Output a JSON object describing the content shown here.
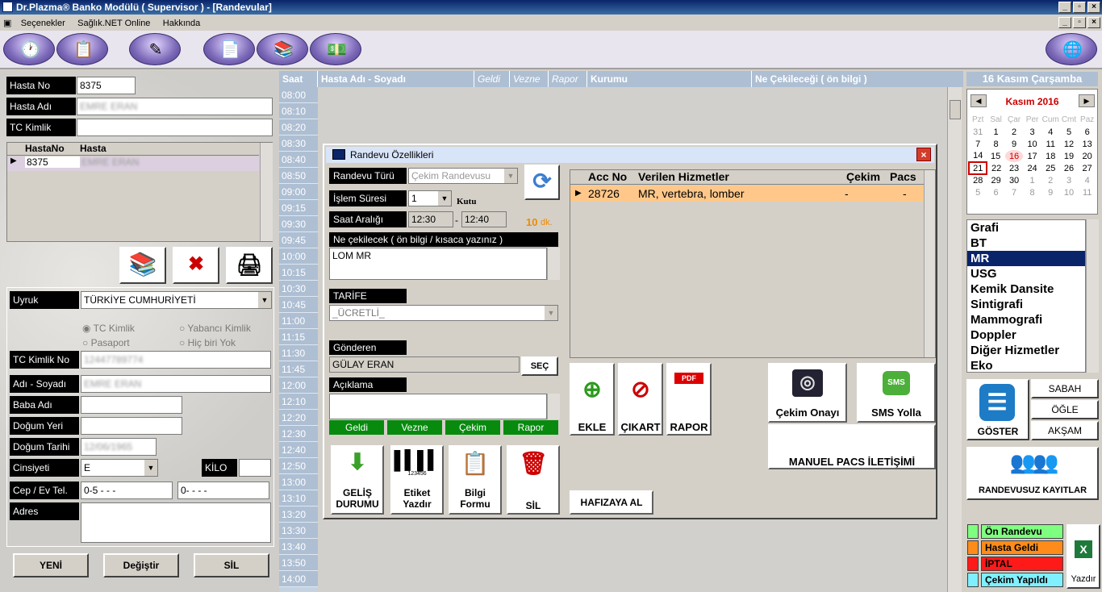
{
  "window": {
    "title": "Dr.Plazma® Banko Modülü ( Supervisor ) - [Randevular]"
  },
  "menu": [
    "Seçenekler",
    "Sağlık.NET Online",
    "Hakkında"
  ],
  "patient": {
    "hasta_no_label": "Hasta No",
    "hasta_no": "8375",
    "hasta_adi_label": "Hasta Adı",
    "hasta_adi": "EMRE ERAN",
    "tc_label": "TC Kimlik",
    "tc": "",
    "grid_headers": [
      "HastaNo",
      "Hasta"
    ],
    "grid_row": {
      "no": "8375",
      "name": "EMRE ERAN"
    }
  },
  "details": {
    "uyruk_label": "Uyruk",
    "uyruk": "TÜRKİYE CUMHURİYETİ",
    "radio_tc": "TC Kimlik",
    "radio_yabanci": "Yabancı Kimlik",
    "radio_pasaport": "Pasaport",
    "radio_hicbiri": "Hiç biri Yok",
    "tc_no_label": "TC Kimlik No",
    "tc_no": "12447789774",
    "ad_soyad_label": "Adı - Soyadı",
    "ad_soyad": "EMRE ERAN",
    "baba_label": "Baba Adı",
    "baba": "",
    "dogum_yeri_label": "Doğum Yeri",
    "dogum_yeri": "",
    "dogum_tarihi_label": "Doğum Tarihi",
    "dogum_tarihi": "12/06/1965",
    "cinsiyet_label": "Cinsiyeti",
    "cinsiyet": "E",
    "kilo_label": "KİLO",
    "kilo": "",
    "tel_label": "Cep / Ev Tel.",
    "cep": "0-5  -  -  -",
    "ev": "0-   -  -  -",
    "adres_label": "Adres",
    "adres": ""
  },
  "bottom_buttons": {
    "yeni": "YENİ",
    "degistir": "Değiştir",
    "sil": "SİL"
  },
  "schedule": {
    "headers": {
      "saat": "Saat",
      "hasta": "Hasta Adı - Soyadı",
      "geldi": "Geldi",
      "vezne": "Vezne",
      "rapor": "Rapor",
      "kurumu": "Kurumu",
      "ne": "Ne Çekileceği ( ön bilgi )"
    },
    "times": [
      "08:00",
      "08:10",
      "08:20",
      "08:30",
      "08:40",
      "08:50",
      "09:00",
      "09:15",
      "09:30",
      "09:45",
      "10:00",
      "10:15",
      "10:30",
      "10:45",
      "11:00",
      "11:15",
      "11:30",
      "11:45",
      "12:00",
      "12:10",
      "12:20",
      "12:30",
      "12:40",
      "12:50",
      "13:00",
      "13:10",
      "13:20",
      "13:30",
      "13:40",
      "13:50",
      "14:00"
    ]
  },
  "dialog": {
    "title": "Randevu Özellikleri",
    "randevu_turu_label": "Randevu Türü",
    "randevu_turu": "Çekim Randevusu",
    "islem_suresi_label": "İşlem Süresi",
    "islem_suresi": "1",
    "kutu": "Kutu",
    "saat_araligi_label": "Saat Aralığı",
    "saat_bas": "12:30",
    "saat_bit": "12:40",
    "dash": "-",
    "dk_value": "10",
    "dk_unit": "dk.",
    "ne_label": "Ne çekilecek ( ön bilgi / kısaca yazınız )",
    "ne": "LOM MR",
    "tarife_label": "TARİFE",
    "tarife": "_ÜCRETLİ_",
    "gonderen_label": "Gönderen",
    "gonderen": "GÜLAY ERAN",
    "sec": "SEÇ",
    "aciklama_label": "Açıklama",
    "aciklama": "",
    "status": [
      "Geldi",
      "Vezne",
      "Çekim",
      "Rapor"
    ],
    "services_headers": [
      "Acc No",
      "Verilen Hizmetler",
      "Çekim",
      "Pacs"
    ],
    "service_row": {
      "acc": "28726",
      "hizmet": "MR, vertebra, lomber",
      "cekim": "-",
      "pacs": "-"
    },
    "buttons": {
      "gelis": "GELİŞ DURUMU",
      "etiket": "Etiket Yazdır",
      "bilgi": "Bilgi Formu",
      "sil": "SİL",
      "hafiza": "HAFIZAYA AL",
      "ekle": "EKLE",
      "cikart": "ÇIKART",
      "rapor": "RAPOR",
      "cekim_onayi": "Çekim Onayı",
      "sms": "SMS Yolla",
      "manuel": "MANUEL PACS İLETİŞİMİ",
      "barcode": "123456",
      "pdf": "PDF",
      "sms_badge": "SMS"
    }
  },
  "right": {
    "date_header": "16 Kasım Çarşamba",
    "month": "Kasım 2016",
    "weekdays": [
      "Pzt",
      "Sal",
      "Çar",
      "Per",
      "Cum",
      "Cmt",
      "Paz"
    ],
    "weeks": [
      [
        "31",
        "1",
        "2",
        "3",
        "4",
        "5",
        "6"
      ],
      [
        "7",
        "8",
        "9",
        "10",
        "11",
        "12",
        "13"
      ],
      [
        "14",
        "15",
        "16",
        "17",
        "18",
        "19",
        "20"
      ],
      [
        "21",
        "22",
        "23",
        "24",
        "25",
        "26",
        "27"
      ],
      [
        "28",
        "29",
        "30",
        "1",
        "2",
        "3",
        "4"
      ],
      [
        "5",
        "6",
        "7",
        "8",
        "9",
        "10",
        "11"
      ]
    ],
    "modalities": [
      "Grafi",
      "BT",
      "MR",
      "USG",
      "Kemik Dansite",
      "Sintigrafi",
      "Mammografi",
      "Doppler",
      "Diğer Hizmetler",
      "Eko"
    ],
    "selected_modality": "MR",
    "goster": "GÖSTER",
    "sabah": "SABAH",
    "ogle": "ÖĞLE",
    "aksam": "AKŞAM",
    "randevusuz": "RANDEVUSUZ KAYITLAR",
    "legend": [
      {
        "label": "Ön Randevu",
        "color": "#7fff7f"
      },
      {
        "label": "Hasta Geldi",
        "color": "#ff8c1a"
      },
      {
        "label": "İPTAL",
        "color": "#ff1a1a"
      },
      {
        "label": "Çekim Yapıldı",
        "color": "#7ff0ff"
      }
    ],
    "yazdir": "Yazdır"
  }
}
